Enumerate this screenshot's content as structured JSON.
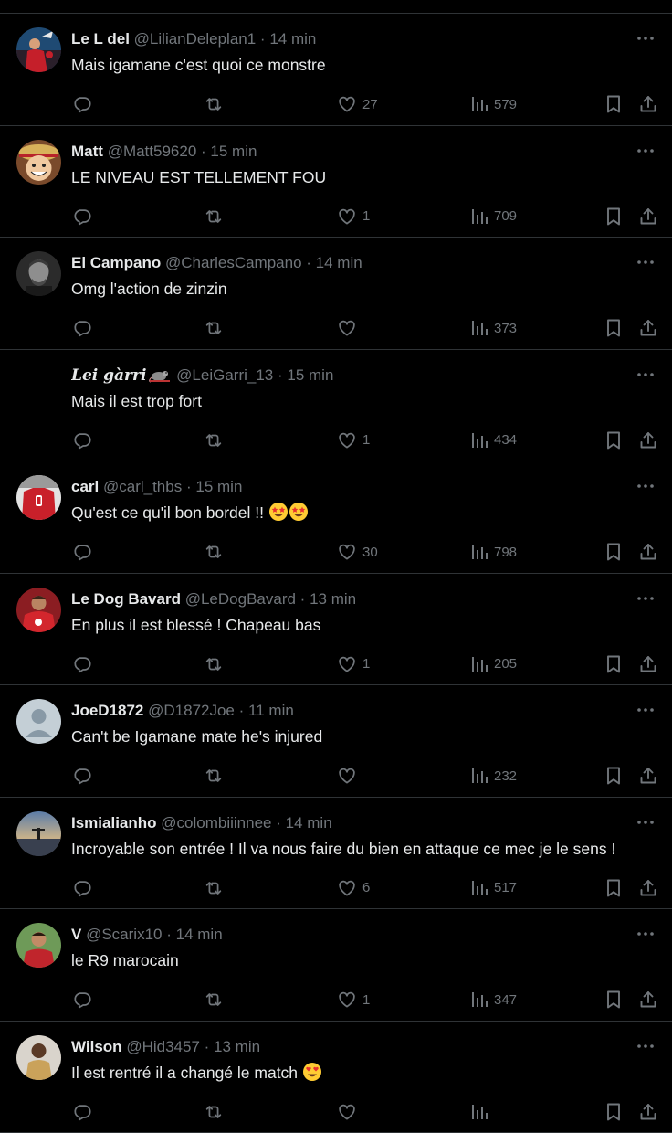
{
  "tweets": [
    {
      "name": "Le L del",
      "handle": "@LilianDeleplan1",
      "dot": "·",
      "time": "14 min",
      "text": "Mais igamane c'est quoi ce monstre",
      "replies": "",
      "retweets": "",
      "likes": "27",
      "views": "579",
      "avatar": "red-sports"
    },
    {
      "name": "Matt",
      "handle": "@Matt59620",
      "dot": "·",
      "time": "15 min",
      "text": "LE NIVEAU EST TELLEMENT FOU",
      "replies": "",
      "retweets": "",
      "likes": "1",
      "views": "709",
      "avatar": "cartoon"
    },
    {
      "name": "El Campano",
      "handle": "@CharlesCampano",
      "dot": "·",
      "time": "14 min",
      "text": "Omg l'action de zinzin",
      "replies": "",
      "retweets": "",
      "likes": "",
      "views": "373",
      "avatar": "bw-portrait"
    },
    {
      "name": "Lei gàrri",
      "handle": "@LeiGarri_13",
      "dot": "·",
      "time": "15 min",
      "text": "Mais il est trop fort",
      "replies": "",
      "retweets": "",
      "likes": "1",
      "views": "434",
      "avatar": "none",
      "name_italic": true,
      "badge": "rat-emoji"
    },
    {
      "name": "carl",
      "handle": "@carl_thbs",
      "dot": "·",
      "time": "15 min",
      "text": "Qu'est ce qu'il bon bordel !!",
      "replies": "",
      "retweets": "",
      "likes": "30",
      "views": "798",
      "avatar": "red-jersey",
      "emoji": [
        "star-struck",
        "star-struck"
      ]
    },
    {
      "name": "Le Dog Bavard",
      "handle": "@LeDogBavard",
      "dot": "·",
      "time": "13 min",
      "text": "En plus il est blessé ! Chapeau bas",
      "replies": "",
      "retweets": "",
      "likes": "1",
      "views": "205",
      "avatar": "red-player"
    },
    {
      "name": "JoeD1872",
      "handle": "@D1872Joe",
      "dot": "·",
      "time": "11 min",
      "text": "Can't be Igamane mate he's injured",
      "replies": "",
      "retweets": "",
      "likes": "",
      "views": "232",
      "avatar": "default"
    },
    {
      "name": "Ismialianho",
      "handle": "@colombiiinnee",
      "dot": "·",
      "time": "14 min",
      "text": "Incroyable son entrée ! Il va nous faire du bien en attaque ce mec je le sens !",
      "replies": "",
      "retweets": "",
      "likes": "6",
      "views": "517",
      "avatar": "sunset"
    },
    {
      "name": "V",
      "handle": "@Scarix10",
      "dot": "·",
      "time": "14 min",
      "text": "le R9 marocain",
      "replies": "",
      "retweets": "",
      "likes": "1",
      "views": "347",
      "avatar": "green-person"
    },
    {
      "name": "Wilson",
      "handle": "@Hid3457",
      "dot": "·",
      "time": "13 min",
      "text": "Il est rentré il a changé le match",
      "replies": "",
      "retweets": "",
      "likes": "",
      "views": "",
      "avatar": "brown-person",
      "emoji": [
        "heart-eyes"
      ]
    }
  ],
  "colors": {
    "background": "#000000",
    "text": "#e7e9ea",
    "muted": "#71767b",
    "divider": "#2f3336"
  }
}
